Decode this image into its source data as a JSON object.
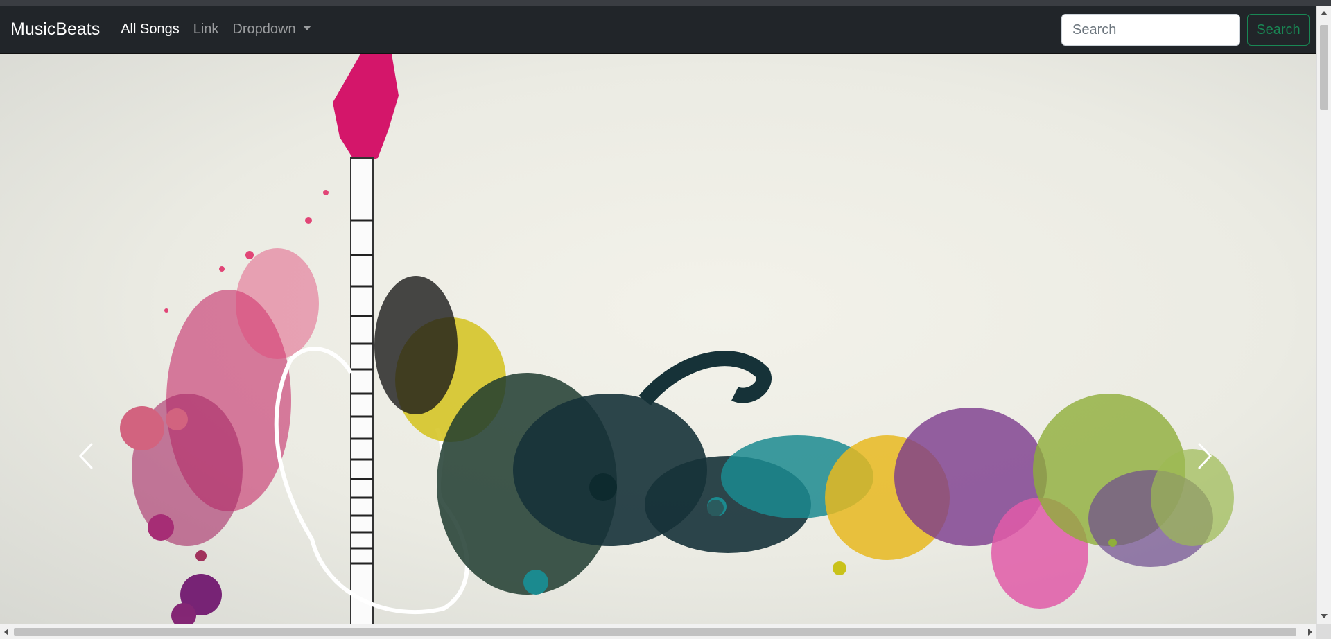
{
  "navbar": {
    "brand": "MusicBeats",
    "links": [
      {
        "label": "All Songs",
        "active": true
      },
      {
        "label": "Link",
        "active": false
      },
      {
        "label": "Dropdown",
        "active": false
      }
    ],
    "search": {
      "placeholder": "Search",
      "value": "",
      "button_label": "Search"
    }
  },
  "hero": {
    "icons": {
      "prev": "chevron-left-icon",
      "next": "chevron-right-icon"
    }
  },
  "colors": {
    "navbar_bg": "#212529",
    "accent_green": "#198754",
    "magenta": "#c2185b",
    "teal": "#1b8a8f",
    "yellow": "#d4c21c",
    "purple": "#7b3a8c",
    "olive": "#8fae3a"
  }
}
